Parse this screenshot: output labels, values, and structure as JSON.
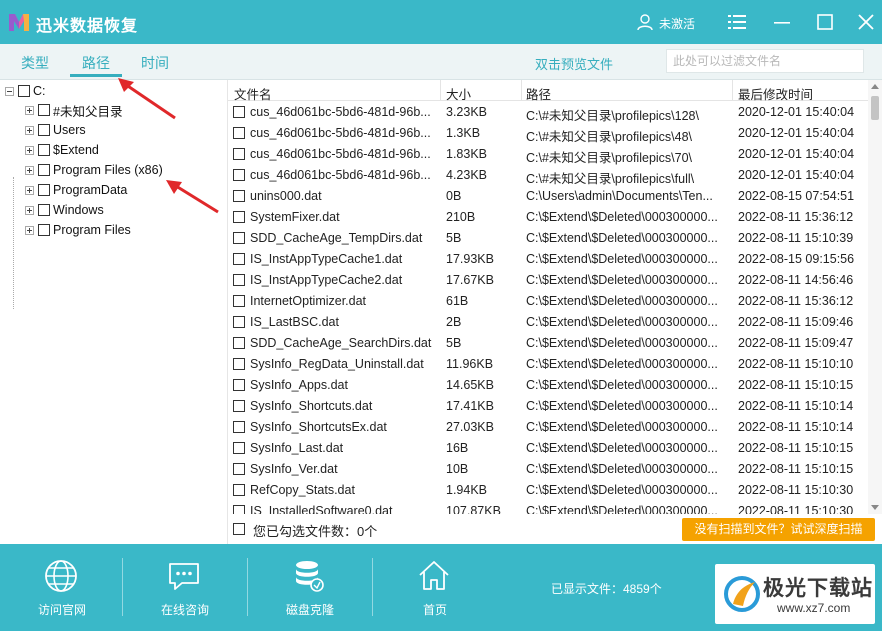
{
  "titlebar": {
    "app_title": "迅米数据恢复",
    "user_label": "未激活",
    "bg_color": "#3ab8c8"
  },
  "tabs": {
    "items": [
      {
        "label": "类型"
      },
      {
        "label": "路径",
        "active": true
      },
      {
        "label": "时间"
      }
    ],
    "preview_link": "双击预览文件",
    "filter_placeholder": "此处可以过滤文件名",
    "accent_color": "#36aebe"
  },
  "tree": {
    "root": "C:",
    "items": [
      {
        "label": "#未知父目录"
      },
      {
        "label": "Users"
      },
      {
        "label": "$Extend"
      },
      {
        "label": "Program Files (x86)"
      },
      {
        "label": "ProgramData"
      },
      {
        "label": "Windows"
      },
      {
        "label": "Program Files"
      }
    ]
  },
  "filelist": {
    "columns": [
      "文件名",
      "大小",
      "路径",
      "最后修改时间"
    ],
    "rows": [
      [
        "cus_46d061bc-5bd6-481d-96b...",
        "3.23KB",
        "C:\\#未知父目录\\profilepics\\128\\",
        "2020-12-01 15:40:04"
      ],
      [
        "cus_46d061bc-5bd6-481d-96b...",
        "1.3KB",
        "C:\\#未知父目录\\profilepics\\48\\",
        "2020-12-01 15:40:04"
      ],
      [
        "cus_46d061bc-5bd6-481d-96b...",
        "1.83KB",
        "C:\\#未知父目录\\profilepics\\70\\",
        "2020-12-01 15:40:04"
      ],
      [
        "cus_46d061bc-5bd6-481d-96b...",
        "4.23KB",
        "C:\\#未知父目录\\profilepics\\full\\",
        "2020-12-01 15:40:04"
      ],
      [
        "unins000.dat",
        "0B",
        "C:\\Users\\admin\\Documents\\Ten...",
        "2022-08-15 07:54:51"
      ],
      [
        "SystemFixer.dat",
        "210B",
        "C:\\$Extend\\$Deleted\\000300000...",
        "2022-08-11 15:36:12"
      ],
      [
        "SDD_CacheAge_TempDirs.dat",
        "5B",
        "C:\\$Extend\\$Deleted\\000300000...",
        "2022-08-11 15:10:39"
      ],
      [
        "IS_InstAppTypeCache1.dat",
        "17.93KB",
        "C:\\$Extend\\$Deleted\\000300000...",
        "2022-08-15 09:15:56"
      ],
      [
        "IS_InstAppTypeCache2.dat",
        "17.67KB",
        "C:\\$Extend\\$Deleted\\000300000...",
        "2022-08-11 14:56:46"
      ],
      [
        "InternetOptimizer.dat",
        "61B",
        "C:\\$Extend\\$Deleted\\000300000...",
        "2022-08-11 15:36:12"
      ],
      [
        "IS_LastBSC.dat",
        "2B",
        "C:\\$Extend\\$Deleted\\000300000...",
        "2022-08-11 15:09:46"
      ],
      [
        "SDD_CacheAge_SearchDirs.dat",
        "5B",
        "C:\\$Extend\\$Deleted\\000300000...",
        "2022-08-11 15:09:47"
      ],
      [
        "SysInfo_RegData_Uninstall.dat",
        "11.96KB",
        "C:\\$Extend\\$Deleted\\000300000...",
        "2022-08-11 15:10:10"
      ],
      [
        "SysInfo_Apps.dat",
        "14.65KB",
        "C:\\$Extend\\$Deleted\\000300000...",
        "2022-08-11 15:10:15"
      ],
      [
        "SysInfo_Shortcuts.dat",
        "17.41KB",
        "C:\\$Extend\\$Deleted\\000300000...",
        "2022-08-11 15:10:14"
      ],
      [
        "SysInfo_ShortcutsEx.dat",
        "27.03KB",
        "C:\\$Extend\\$Deleted\\000300000...",
        "2022-08-11 15:10:14"
      ],
      [
        "SysInfo_Last.dat",
        "16B",
        "C:\\$Extend\\$Deleted\\000300000...",
        "2022-08-11 15:10:15"
      ],
      [
        "SysInfo_Ver.dat",
        "10B",
        "C:\\$Extend\\$Deleted\\000300000...",
        "2022-08-11 15:10:15"
      ],
      [
        "RefCopy_Stats.dat",
        "1.94KB",
        "C:\\$Extend\\$Deleted\\000300000...",
        "2022-08-11 15:10:30"
      ],
      [
        "IS_InstalledSoftware0.dat",
        "107.87KB",
        "C:\\$Extend\\$Deleted\\000300000...",
        "2022-08-11 15:10:30"
      ]
    ]
  },
  "selection": {
    "label": "您已勾选文件数：0个",
    "deep_scan": "没有扫描到文件？试试深度扫描",
    "deep_scan_color": "#f5a200"
  },
  "footer": {
    "buttons": [
      {
        "label": "访问官网",
        "icon": "globe-icon"
      },
      {
        "label": "在线咨询",
        "icon": "chat-icon"
      },
      {
        "label": "磁盘克隆",
        "icon": "database-icon"
      },
      {
        "label": "首页",
        "icon": "home-icon"
      }
    ],
    "file_count": "已显示文件：4859个",
    "watermark_title": "极光下载站",
    "watermark_url": "www.xz7.com"
  }
}
